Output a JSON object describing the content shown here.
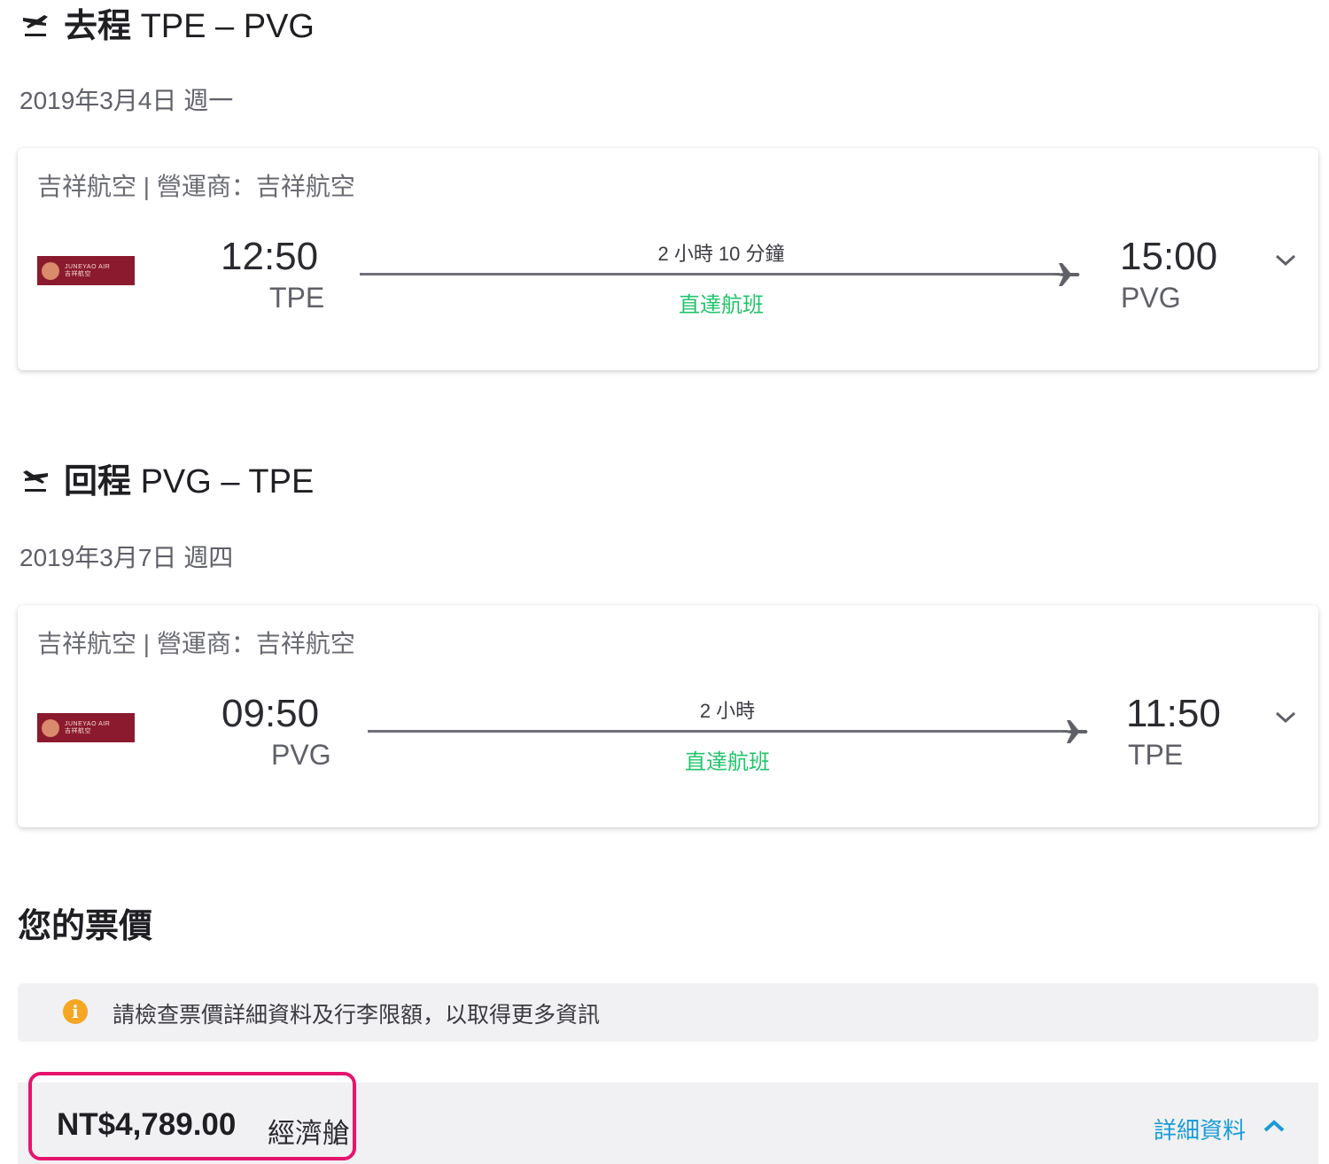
{
  "outbound": {
    "label": "去程",
    "route": "TPE – PVG",
    "date": "2019年3月4日 週一",
    "carrier": "吉祥航空 | 營運商：吉祥航空",
    "depart_time": "12:50",
    "depart_code": "TPE",
    "duration": "2 小時 10 分鐘",
    "stops": "直達航班",
    "arrive_time": "15:00",
    "arrive_code": "PVG"
  },
  "inbound": {
    "label": "回程",
    "route": "PVG – TPE",
    "date": "2019年3月7日 週四",
    "carrier": "吉祥航空 | 營運商：吉祥航空",
    "depart_time": "09:50",
    "depart_code": "PVG",
    "duration": "2 小時",
    "stops": "直達航班",
    "arrive_time": "11:50",
    "arrive_code": "TPE"
  },
  "airline_logo": {
    "name": "JUNEYAO AIR",
    "name_zh": "吉祥航空"
  },
  "fare": {
    "section_title": "您的票價",
    "notice": "請檢查票價詳細資料及行李限額，以取得更多資訊",
    "price": "NT$4,789.00",
    "cabin": "經濟艙",
    "details_label": "詳細資料"
  },
  "colors": {
    "direct_green": "#21c46b",
    "link_blue": "#1a9bd7",
    "highlight_pink": "#e5156e",
    "info_orange": "#f5a623",
    "logo_maroon": "#8b1a2e"
  }
}
